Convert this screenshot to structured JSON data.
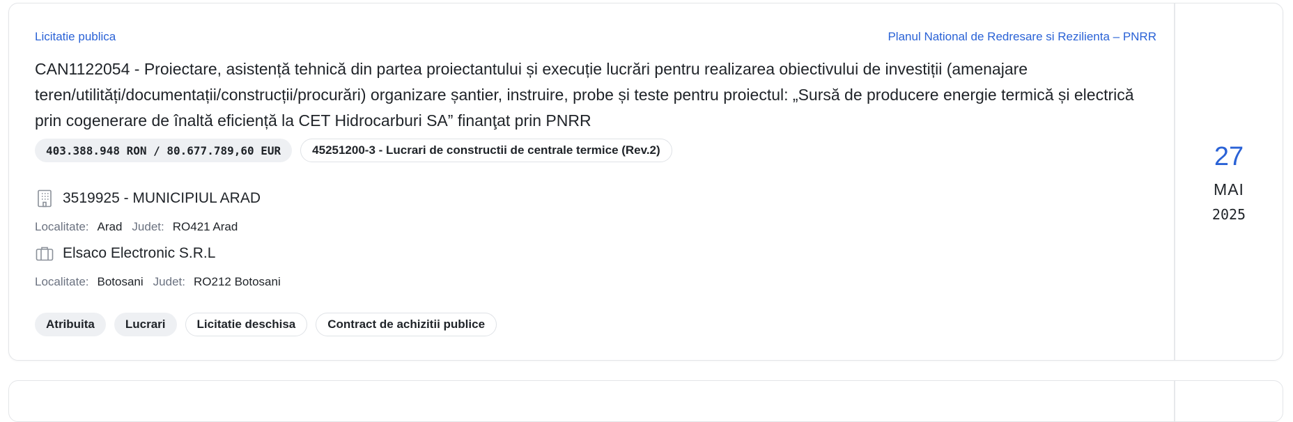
{
  "card": {
    "procedure_type": "Licitatie publica",
    "program": "Planul National de Redresare si Rezilienta – PNRR",
    "title": "CAN1122054 - Proiectare, asistență tehnică din partea proiectantului și execuție lucrări pentru realizarea obiectivului de investiții (amenajare teren/utilități/documentații/construcții/procurări) organizare șantier, instruire, probe și teste pentru proiectul: „Sursă de producere energie termică și electrică prin cogenerare de înaltă eficiență la CET Hidrocarburi SA” finanţat prin PNRR",
    "value": "403.388.948 RON / 80.677.789,60 EUR",
    "cpv": "45251200-3 - Lucrari de constructii de centrale termice (Rev.2)",
    "authority": {
      "name": "3519925 - MUNICIPIUL ARAD",
      "icon": "building-icon",
      "localitate_label": "Localitate:",
      "localitate": "Arad",
      "judet_label": "Judet:",
      "judet": "RO421 Arad"
    },
    "supplier": {
      "name": "Elsaco Electronic S.R.L",
      "icon": "briefcase-icon",
      "localitate_label": "Localitate:",
      "localitate": "Botosani",
      "judet_label": "Judet:",
      "judet": "RO212 Botosani"
    },
    "status_tags": [
      "Atribuita",
      "Lucrari",
      "Licitatie deschisa",
      "Contract de achizitii publice"
    ],
    "date": {
      "day": "27",
      "month": "MAI",
      "year": "2025"
    }
  },
  "colors": {
    "accent": "#2a62d6",
    "border": "#e3e5e8",
    "pill_bg": "#eef0f3"
  }
}
